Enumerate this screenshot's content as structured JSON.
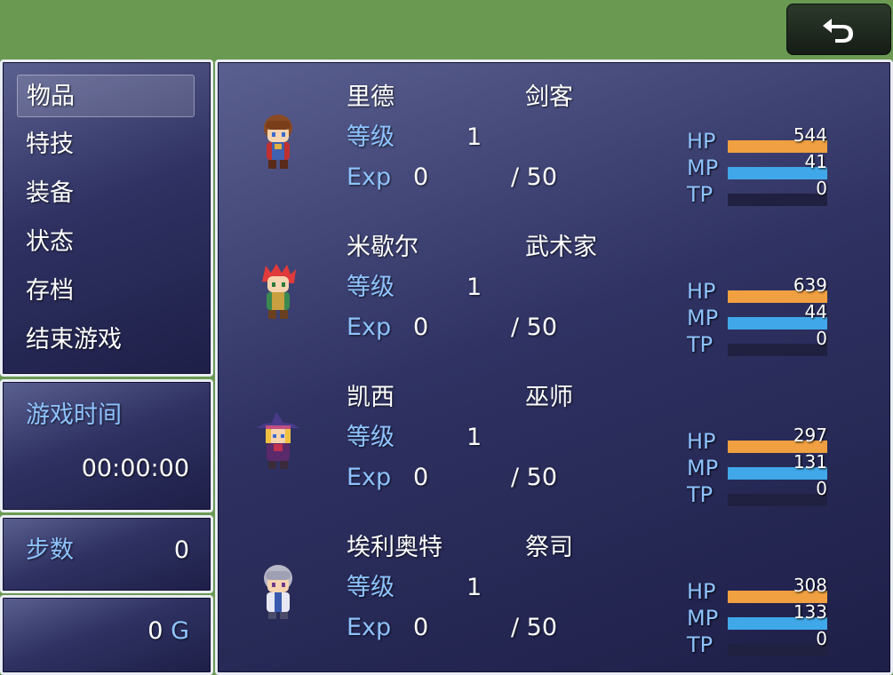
{
  "menu": {
    "items": [
      {
        "label": "物品"
      },
      {
        "label": "特技"
      },
      {
        "label": "装备"
      },
      {
        "label": "状态"
      },
      {
        "label": "存档"
      },
      {
        "label": "结束游戏"
      }
    ],
    "selected_index": 0
  },
  "playtime": {
    "label": "游戏时间",
    "value": "00:00:00"
  },
  "steps": {
    "label": "步数",
    "value": "0"
  },
  "gold": {
    "value": "0",
    "unit": "G"
  },
  "back_button": {
    "icon": "return-arrow-icon"
  },
  "actors": [
    {
      "name": "里德",
      "class": "剑客",
      "level_label": "等级",
      "level": "1",
      "exp_label": "Exp",
      "exp": "0",
      "exp_next": "/ 50",
      "hp_label": "HP",
      "hp": "544",
      "mp_label": "MP",
      "mp": "41",
      "tp_label": "TP",
      "tp": "0",
      "hp_fill": 1.0,
      "mp_fill": 1.0,
      "tp_fill": 0.0
    },
    {
      "name": "米歇尔",
      "class": "武术家",
      "level_label": "等级",
      "level": "1",
      "exp_label": "Exp",
      "exp": "0",
      "exp_next": "/ 50",
      "hp_label": "HP",
      "hp": "639",
      "mp_label": "MP",
      "mp": "44",
      "tp_label": "TP",
      "tp": "0",
      "hp_fill": 1.0,
      "mp_fill": 1.0,
      "tp_fill": 0.0
    },
    {
      "name": "凯西",
      "class": "巫师",
      "level_label": "等级",
      "level": "1",
      "exp_label": "Exp",
      "exp": "0",
      "exp_next": "/ 50",
      "hp_label": "HP",
      "hp": "297",
      "mp_label": "MP",
      "mp": "131",
      "tp_label": "TP",
      "tp": "0",
      "hp_fill": 1.0,
      "mp_fill": 1.0,
      "tp_fill": 0.0
    },
    {
      "name": "埃利奥特",
      "class": "祭司",
      "level_label": "等级",
      "level": "1",
      "exp_label": "Exp",
      "exp": "0",
      "exp_next": "/ 50",
      "hp_label": "HP",
      "hp": "308",
      "mp_label": "MP",
      "mp": "133",
      "tp_label": "TP",
      "tp": "0",
      "hp_fill": 1.0,
      "mp_fill": 1.0,
      "tp_fill": 0.0
    }
  ],
  "colors": {
    "hp_gauge": "#f0a040",
    "mp_gauge": "#40a8e8",
    "system_text": "#8ec3ff",
    "window_border": "#e9ecf5"
  }
}
